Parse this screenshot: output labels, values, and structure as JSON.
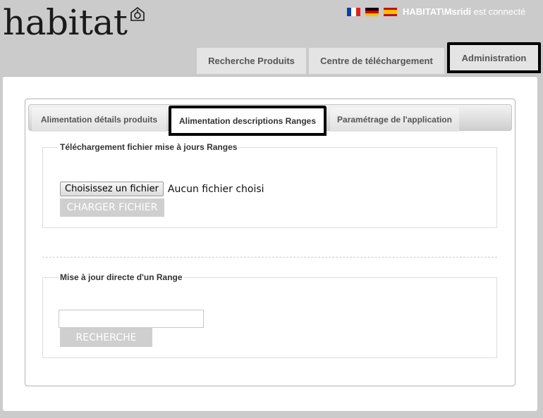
{
  "header": {
    "logo_text": "habitat",
    "user_name": "HABITAT\\Msridi",
    "user_status_suffix": " est connecté",
    "languages": [
      {
        "name": "fr-flag-icon"
      },
      {
        "name": "de-flag-icon"
      },
      {
        "name": "es-flag-icon"
      }
    ]
  },
  "main_tabs": [
    {
      "label": "Recherche Produits"
    },
    {
      "label": "Centre de téléchargement"
    },
    {
      "label": "Administration",
      "active": true
    }
  ],
  "sub_tabs": [
    {
      "label": "Alimentation détails produits"
    },
    {
      "label": "Alimentation descriptions Ranges",
      "active": true
    },
    {
      "label": "Paramétrage de l'application"
    }
  ],
  "upload_section": {
    "legend": "Téléchargement fichier mise à jours Ranges",
    "file_button_label": "Choisissez un fichier",
    "file_status": "Aucun fichier choisi",
    "submit_label": "CHARGER FICHIER"
  },
  "direct_update_section": {
    "legend": "Mise à jour directe d'un Range",
    "search_value": "",
    "search_label": "RECHERCHE"
  },
  "colors": {
    "background": "#cbcbcb",
    "highlight_border": "#000000",
    "button_gray": "#cfcfcf"
  }
}
